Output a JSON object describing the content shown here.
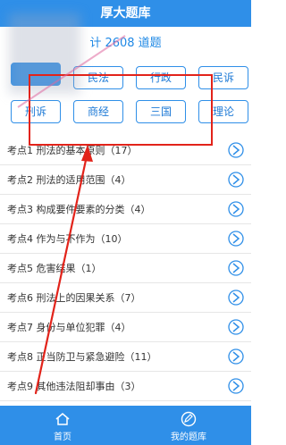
{
  "header": {
    "title": "厚大题库"
  },
  "summary": {
    "text": "计 2608 道题"
  },
  "subjects": [
    {
      "label": "",
      "active": true
    },
    {
      "label": "民法"
    },
    {
      "label": "行政"
    },
    {
      "label": "民诉"
    },
    {
      "label": "刑诉"
    },
    {
      "label": "商经"
    },
    {
      "label": "三国"
    },
    {
      "label": "理论"
    }
  ],
  "topics": [
    "考点1 刑法的基本原则（17）",
    "考点2 刑法的适用范围（4）",
    "考点3 构成要件要素的分类（4）",
    "考点4 作为与不作为（10）",
    "考点5 危害结果（1）",
    "考点6 刑法上的因果关系（7）",
    "考点7 身份与单位犯罪（4）",
    "考点8 正当防卫与紧急避险（11）",
    "考点9 其他违法阻却事由（3）"
  ],
  "footer": {
    "home": "首页",
    "mine": "我的题库"
  },
  "colors": {
    "primary": "#2f8fe8",
    "annotation": "#e2231a"
  }
}
